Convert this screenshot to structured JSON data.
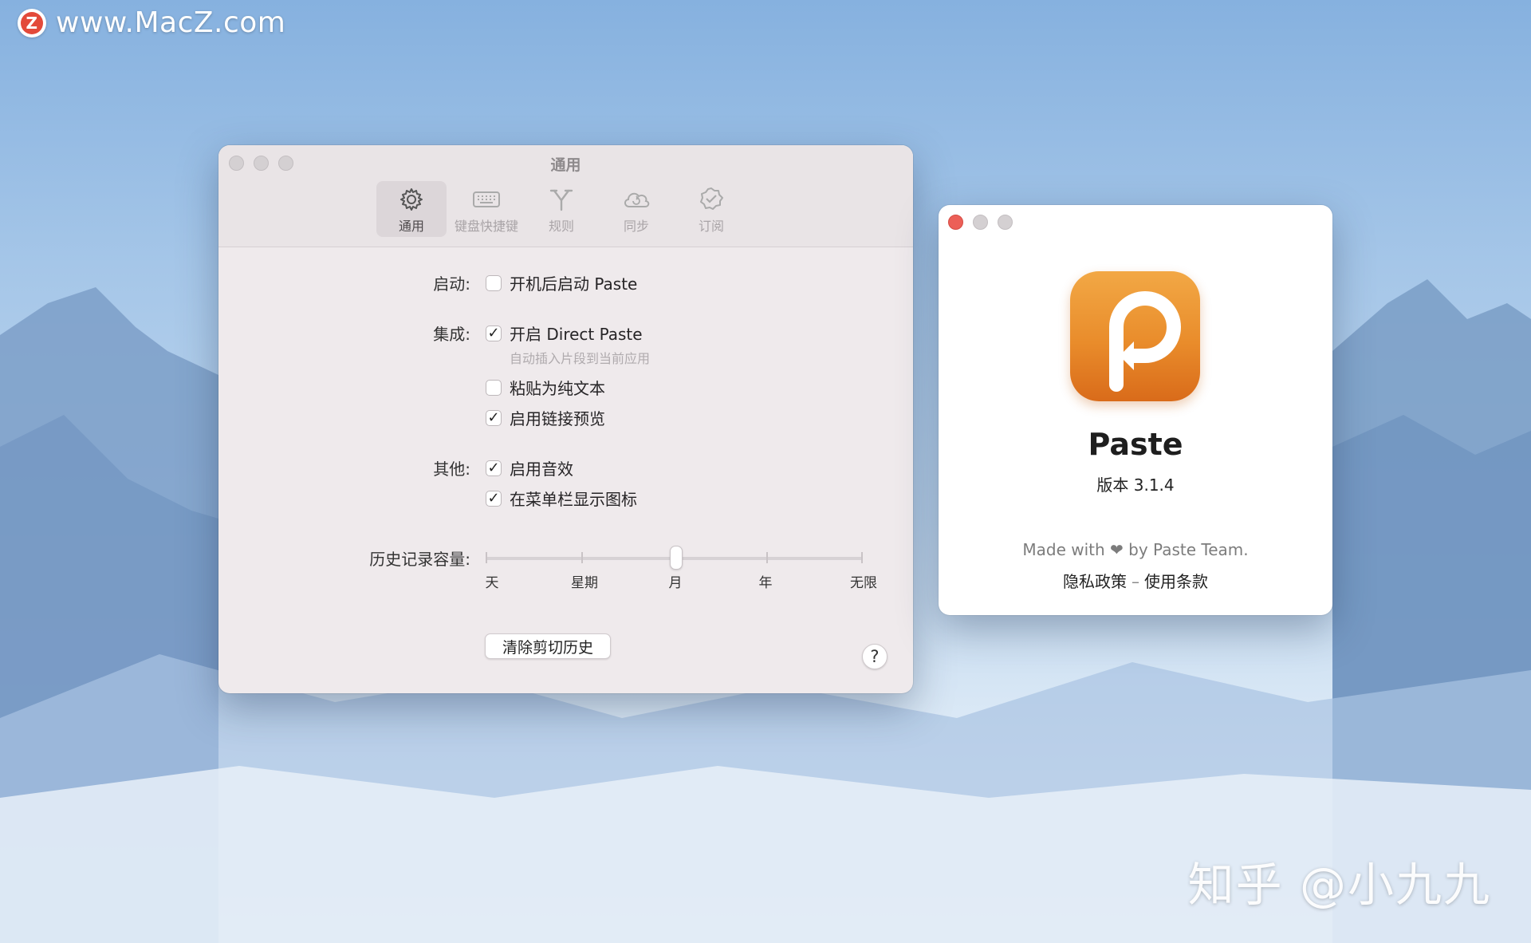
{
  "watermark": {
    "site": "www.MacZ.com",
    "author": "知乎 @小九九"
  },
  "prefs": {
    "title": "通用",
    "toolbar": [
      {
        "label": "通用",
        "icon": "gear-icon",
        "active": true
      },
      {
        "label": "键盘快捷键",
        "icon": "keyboard-icon",
        "active": false
      },
      {
        "label": "规则",
        "icon": "rules-icon",
        "active": false
      },
      {
        "label": "同步",
        "icon": "cloud-sync-icon",
        "active": false
      },
      {
        "label": "订阅",
        "icon": "badge-check-icon",
        "active": false
      }
    ],
    "startup": {
      "label": "启动:",
      "launch_at_login": {
        "text": "开机后启动 Paste",
        "checked": false
      }
    },
    "integration": {
      "label": "集成:",
      "direct_paste": {
        "text": "开启 Direct Paste",
        "checked": true,
        "hint": "自动插入片段到当前应用"
      },
      "plain_text": {
        "text": "粘贴为纯文本",
        "checked": false
      },
      "link_preview": {
        "text": "启用链接预览",
        "checked": true
      }
    },
    "other": {
      "label": "其他:",
      "sound": {
        "text": "启用音效",
        "checked": true
      },
      "menubar_icon": {
        "text": "在菜单栏显示图标",
        "checked": true
      }
    },
    "history": {
      "label": "历史记录容量:",
      "ticks": [
        "天",
        "星期",
        "月",
        "年",
        "无限"
      ],
      "selected": "月"
    },
    "clear_button": "清除剪切历史",
    "help_button": "?"
  },
  "about": {
    "app_name": "Paste",
    "version": "版本 3.1.4",
    "made_with": "Made with ❤ by Paste Team.",
    "privacy_link": "隐私政策",
    "separator": "–",
    "terms_link": "使用条款"
  },
  "colors": {
    "accent_orange": "#e98c2b",
    "close_red": "#ec5f57",
    "window_bg": "#efeaec"
  }
}
